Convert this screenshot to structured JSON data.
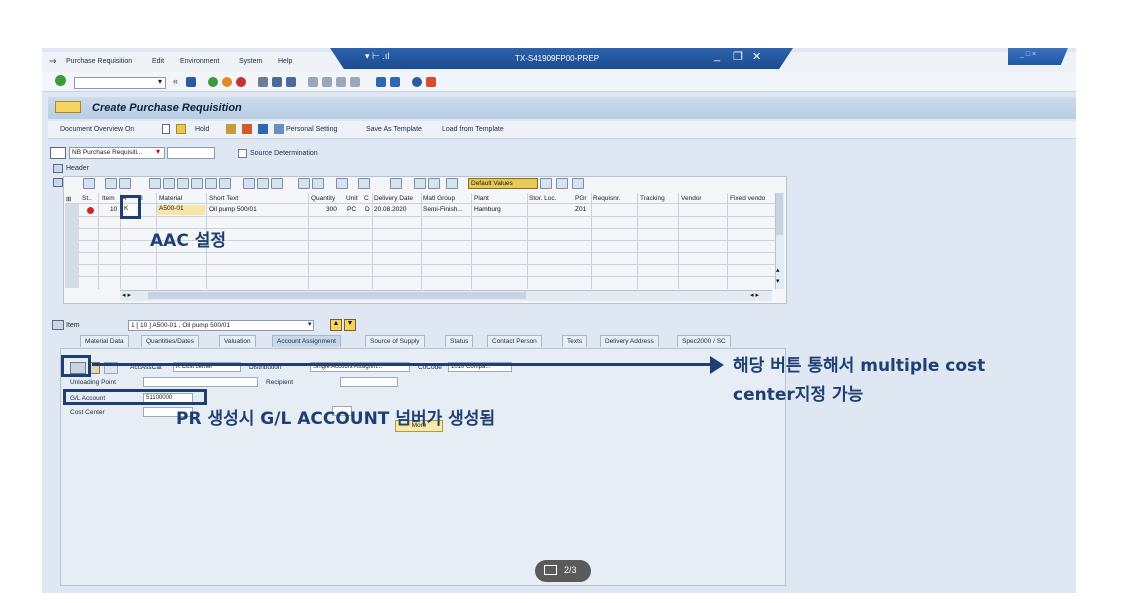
{
  "window": {
    "menu": [
      "Purchase Requisition",
      "Edit",
      "Environment",
      "System",
      "Help"
    ],
    "system_id": "TX-S41909FP00-PREP",
    "outer_controls": "_ □ ×"
  },
  "page_title": "Create Purchase Requisition",
  "app_toolbar": {
    "document_overview": "Document Overview On",
    "hold": "Hold",
    "personal_setting": "Personal Setting",
    "save_as_template": "Save As Template",
    "load_from_template": "Load from Template"
  },
  "doc_type": "NB Purchase Requisiti...",
  "source_determination": "Source Determination",
  "header_label": "Header",
  "grid": {
    "default_values": "Default Values",
    "columns": [
      "St..",
      "Item",
      "A",
      "I",
      "Material",
      "Short Text",
      "Quantity",
      "Unit",
      "C",
      "Delivery Date",
      "Matl Group",
      "Plant",
      "Stor. Loc.",
      "PGr",
      "Requisnr.",
      "Tracking",
      "Vendor",
      "Fixed vendo"
    ],
    "row": {
      "item": "10",
      "acct_cat": "K",
      "material": "A500-01",
      "short_text": "Oil pump 500/01",
      "quantity": "300",
      "unit": "PC",
      "c": "D",
      "delivery_date": "20.08.2020",
      "matl_group": "Semi-Finish...",
      "plant": "Hamburg",
      "pgr": "Z01"
    }
  },
  "item_section": {
    "label": "Item",
    "selected": "1 [ 10 ] A500-01 , Oil pump 500/01"
  },
  "tabs": [
    "Material Data",
    "Quantities/Dates",
    "Valuation",
    "Account Assignment",
    "Source of Supply",
    "Status",
    "Contact Person",
    "Texts",
    "Delivery Address",
    "Spec2000 / SC"
  ],
  "account_assignment": {
    "acc_ass_cat_label": "AccAssCat",
    "acc_ass_cat_value": "K Cost center",
    "distribution_label": "Distribution",
    "distribution_value": "Single Account Assignm...",
    "cocode_label": "CoCode",
    "cocode_value": "1010 Compa...",
    "unloading_point": "Unloading Point",
    "recipient": "Recipient",
    "gl_account_label": "G/L Account",
    "gl_account_value": "51100000",
    "cost_center": "Cost Center",
    "more_button": "More"
  },
  "annotations": {
    "aac": "AAC 설정",
    "button_note_1": "해당 버튼 통해서 multiple cost",
    "button_note_2": "center지정 가능",
    "pr_note": "PR 생성시 G/L ACCOUNT 넘버가 생성됨"
  },
  "pager": "2/3"
}
